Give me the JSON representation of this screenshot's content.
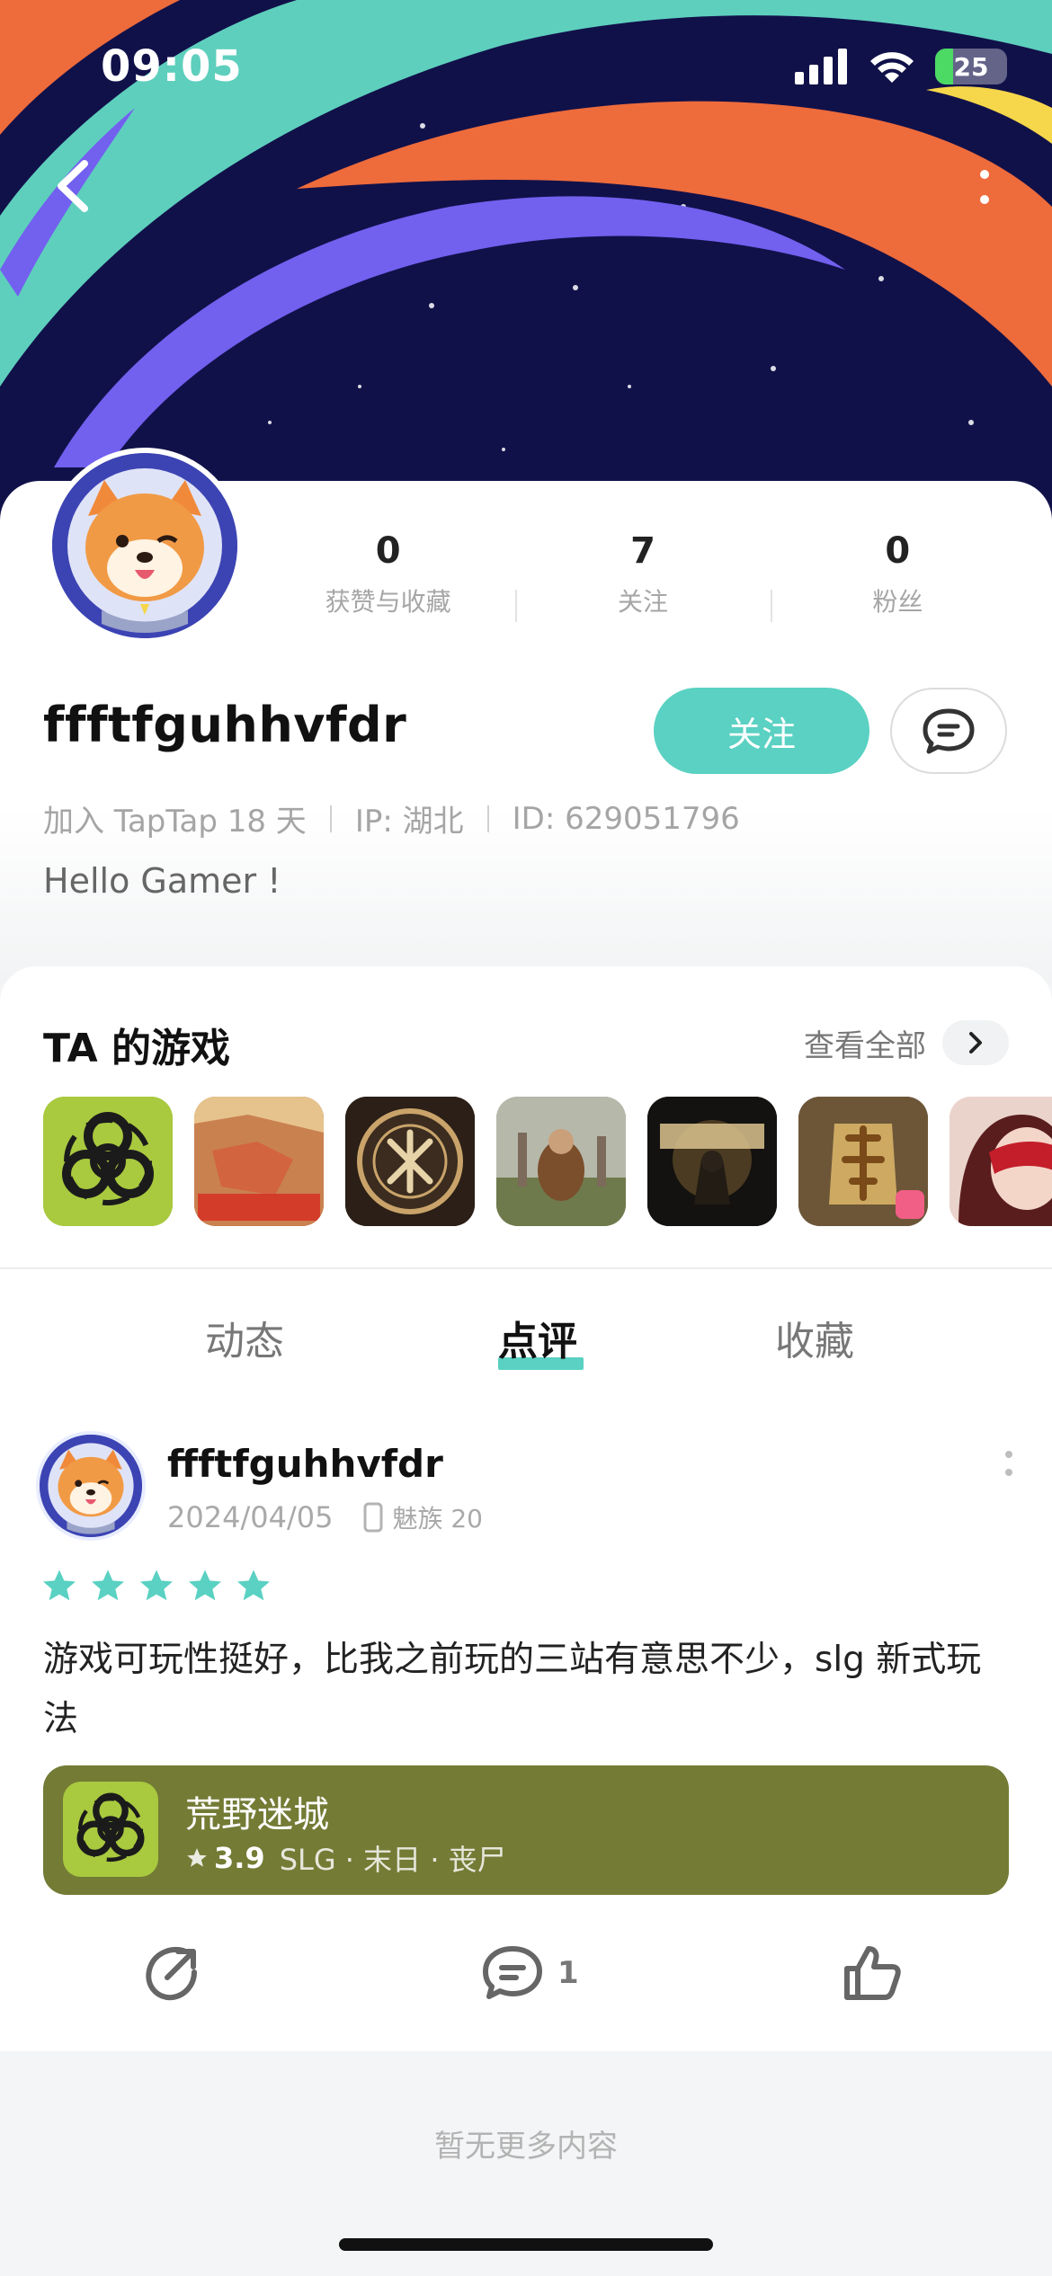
{
  "status_bar": {
    "time": "09:05",
    "battery": "25"
  },
  "header": {
    "back_icon": "chevron-left-icon",
    "more_icon": "vertical-dots-icon"
  },
  "profile": {
    "stats": [
      {
        "value": "0",
        "label": "获赞与收藏"
      },
      {
        "value": "7",
        "label": "关注"
      },
      {
        "value": "0",
        "label": "粉丝"
      }
    ],
    "username": "ffftfguhhvfdr",
    "follow_label": "关注",
    "joined": "加入 TapTap 18 天",
    "ip": "IP: 湖北",
    "id": "ID: 629051796",
    "bio": "Hello Gamer !"
  },
  "games": {
    "title": "TA 的游戏",
    "view_all": "查看全部"
  },
  "tabs": {
    "items": [
      "动态",
      "点评",
      "收藏"
    ],
    "active": "点评"
  },
  "review": {
    "username": "ffftfguhhvfdr",
    "date": "2024/04/05",
    "device": "魅族 20",
    "rating": 5,
    "text": "游戏可玩性挺好，比我之前玩的三站有意思不少，slg 新式玩法",
    "game": {
      "name": "荒野迷城",
      "score": "3.9",
      "tags": "SLG · 末日 · 丧尸"
    },
    "comment_count": "1"
  },
  "footer": {
    "text": "暂无更多内容"
  },
  "colors": {
    "accent": "#5ad1c2",
    "game_card": "#737b35"
  }
}
